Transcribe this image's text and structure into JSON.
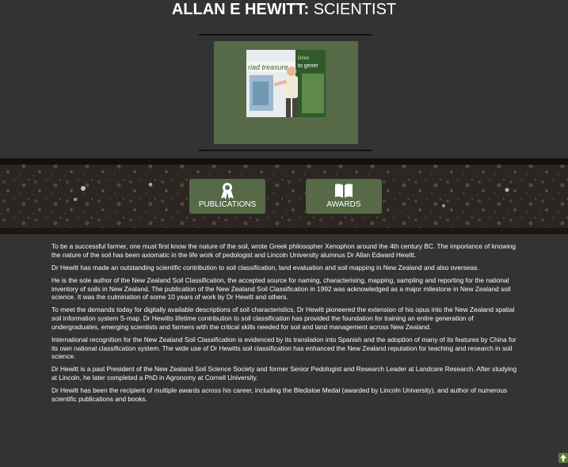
{
  "header": {
    "name": "ALLAN E HEWITT:",
    "role": " SCIENTIST"
  },
  "photo": {
    "banner_text_1": "riad treasure",
    "banner_text_2": "to gener",
    "banner_text_3": "Drive"
  },
  "tiles": [
    {
      "label": "PUBLICATIONS",
      "icon": "award-ribbon-icon"
    },
    {
      "label": "AWARDS",
      "icon": "open-book-icon"
    }
  ],
  "colors": {
    "background": "#333333",
    "accent": "#566a48"
  },
  "paragraphs": [
    "To be a successful farmer, one must first know the nature of the soil, wrote Greek philosopher Xenophon around the 4th century BC. The importance of knowing the nature of the soil has been axiomatic in the life work of pedologist and Lincoln University alumnus Dr Allan Edward Hewitt.",
    "Dr Hewitt has made an outstanding scientific contribution to soil classification, land evaluation and soil mapping in New Zealand and also overseas.",
    "He is the sole author of the New Zealand Soil Classification, the accepted source for naming, characterising, mapping, sampling and reporting for the national inventory of soils in New Zealand. The publication of the New Zealand Soil Classification in 1992 was acknowledged as a major milestone in New Zealand soil science. It was the culmination of some 10 years of work by Dr Hewitt and others.",
    "To meet the demands today for digitally available descriptions of soil characteristics, Dr Hewitt pioneered the extension of his opus into the New Zealand spatial soil information system S-map. Dr Hewitts lifetime contribution to soil classification has provided the foundation for training an entire generation of undergraduates, emerging scientists and farmers with the critical skills needed for soil and land management across New Zealand.",
    "International recognition for the New Zealand Soil Classification is evidenced by its translation into Spanish and the adoption of many of its features by China for its own national classification system. The wide use of Dr Hewitts soil classification has enhanced the New Zealand reputation for teaching and research in soil science.",
    "Dr Hewitt is a past President of the New Zealand Soil Science Society and former Senior Pedologist and Research Leader at Landcare Research. After studying at Lincoln, he later completed a PhD in Agronomy at Cornell University.",
    "Dr Hewitt has been the recipient of multiple awards across his career, including the Bledisloe Medal (awarded by Lincoln University), and author of numerous scientific publications and books."
  ]
}
